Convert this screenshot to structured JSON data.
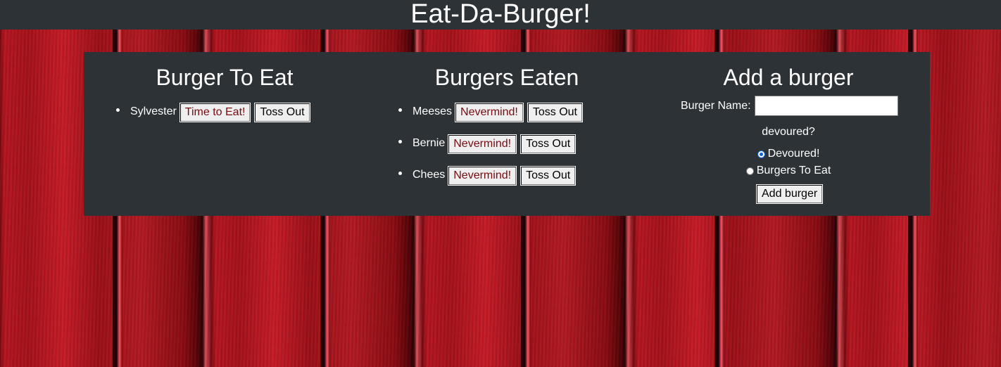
{
  "header": {
    "title": "Eat-Da-Burger!"
  },
  "to_eat": {
    "title": "Burger To Eat",
    "items": [
      {
        "name": "Sylvester",
        "primary_action": "Time to Eat!",
        "secondary_action": "Toss Out"
      }
    ]
  },
  "eaten": {
    "title": "Burgers Eaten",
    "items": [
      {
        "name": "Meeses",
        "primary_action": "Nevermind!",
        "secondary_action": "Toss Out"
      },
      {
        "name": "Bernie",
        "primary_action": "Nevermind!",
        "secondary_action": "Toss Out"
      },
      {
        "name": "Chees",
        "primary_action": "Nevermind!",
        "secondary_action": "Toss Out"
      }
    ]
  },
  "add_form": {
    "title": "Add a burger",
    "name_label": "Burger Name:",
    "name_value": "",
    "question": "devoured?",
    "options": [
      {
        "label": "Devoured!",
        "checked": true
      },
      {
        "label": "Burgers To Eat",
        "checked": false
      }
    ],
    "submit_label": "Add burger"
  },
  "colors": {
    "panel_bg": "#2d3236",
    "header_bg": "#2d3236",
    "action_text": "#7a0a10",
    "background": "#b81620"
  }
}
